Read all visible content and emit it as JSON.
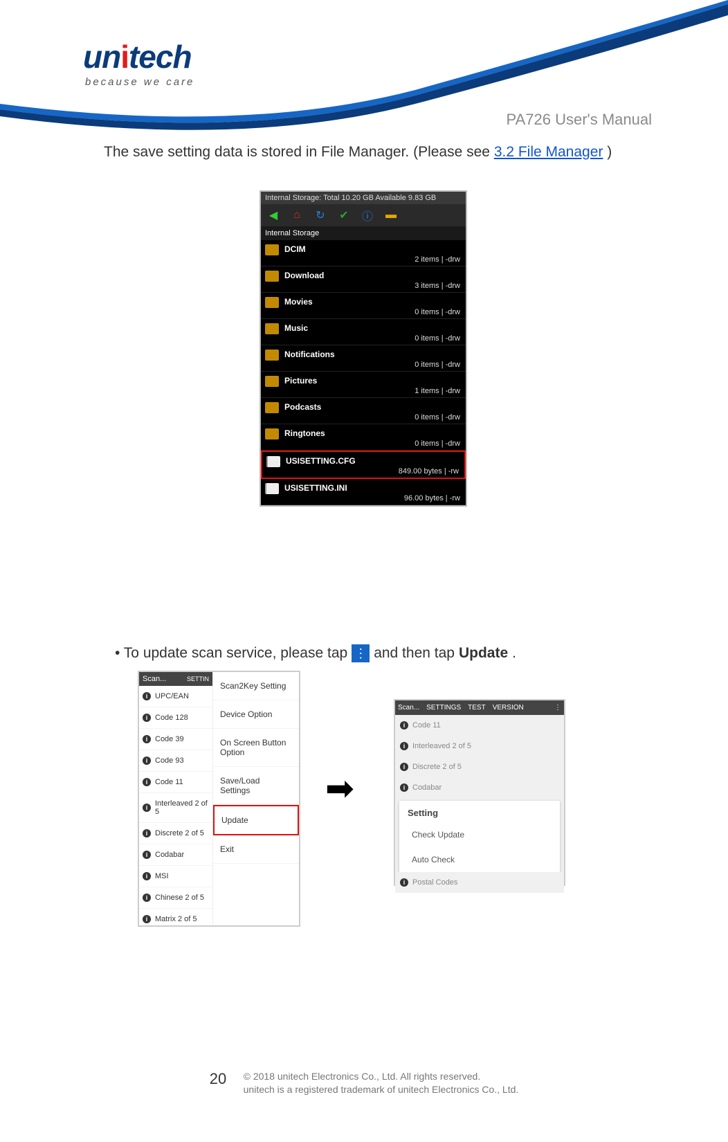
{
  "header": {
    "logo_main": "un",
    "logo_mid": "i",
    "logo_end": "tech",
    "tagline": "because we care",
    "doc_title": "PA726 User's Manual"
  },
  "paragraph1_prefix": "The save setting data is stored in File Manager. (Please see ",
  "paragraph1_link": "3.2 File Manager",
  "paragraph1_suffix": " )",
  "fm": {
    "storage_line": "Internal Storage:  Total 10.20 GB  Available 9.83 GB",
    "location": "Internal Storage",
    "items": [
      {
        "name": "DCIM",
        "meta": "2 items | -drw",
        "type": "folder"
      },
      {
        "name": "Download",
        "meta": "3 items | -drw",
        "type": "folder"
      },
      {
        "name": "Movies",
        "meta": "0 items | -drw",
        "type": "folder"
      },
      {
        "name": "Music",
        "meta": "0 items | -drw",
        "type": "folder"
      },
      {
        "name": "Notifications",
        "meta": "0 items | -drw",
        "type": "folder"
      },
      {
        "name": "Pictures",
        "meta": "1 items | -drw",
        "type": "folder"
      },
      {
        "name": "Podcasts",
        "meta": "0 items | -drw",
        "type": "folder"
      },
      {
        "name": "Ringtones",
        "meta": "0 items | -drw",
        "type": "folder"
      },
      {
        "name": "USISETTING.CFG",
        "meta": "849.00 bytes  | -rw",
        "type": "file",
        "highlight": true
      },
      {
        "name": "USISETTING.INI",
        "meta": "96.00 bytes  | -rw",
        "type": "file"
      }
    ]
  },
  "instruction_prefix": "• To update scan service, please tap",
  "instruction_mid": "and then tap",
  "instruction_bold": "Update",
  "instruction_end": ".",
  "scan1": {
    "header": "Scan...",
    "header_tab": "SETTIN",
    "list": [
      "UPC/EAN",
      "Code 128",
      "Code 39",
      "Code 93",
      "Code 11",
      "Interleaved 2 of 5",
      "Discrete 2 of 5",
      "Codabar",
      "MSI",
      "Chinese 2 of 5",
      "Matrix 2 of 5"
    ],
    "menu": [
      {
        "label": "Scan2Key Setting"
      },
      {
        "label": "Device Option"
      },
      {
        "label": "On Screen Button Option"
      },
      {
        "label": "Save/Load Settings"
      },
      {
        "label": "Update",
        "highlight": true
      },
      {
        "label": "Exit"
      }
    ]
  },
  "scan2": {
    "header_title": "Scan...",
    "header_tabs": [
      "SETTINGS",
      "TEST",
      "VERSION"
    ],
    "header_menu": "⋮",
    "bg_list": [
      "Code 11",
      "Interleaved 2 of 5",
      "Discrete 2 of 5",
      "Codabar"
    ],
    "dialog_title": "Setting",
    "dialog_items": [
      "Check Update",
      "Auto Check"
    ],
    "bg_after": "Postal Codes"
  },
  "footer": {
    "page": "20",
    "line1": "© 2018 unitech Electronics Co., Ltd. All rights reserved.",
    "line2": "unitech is a registered trademark of unitech Electronics Co., Ltd."
  }
}
